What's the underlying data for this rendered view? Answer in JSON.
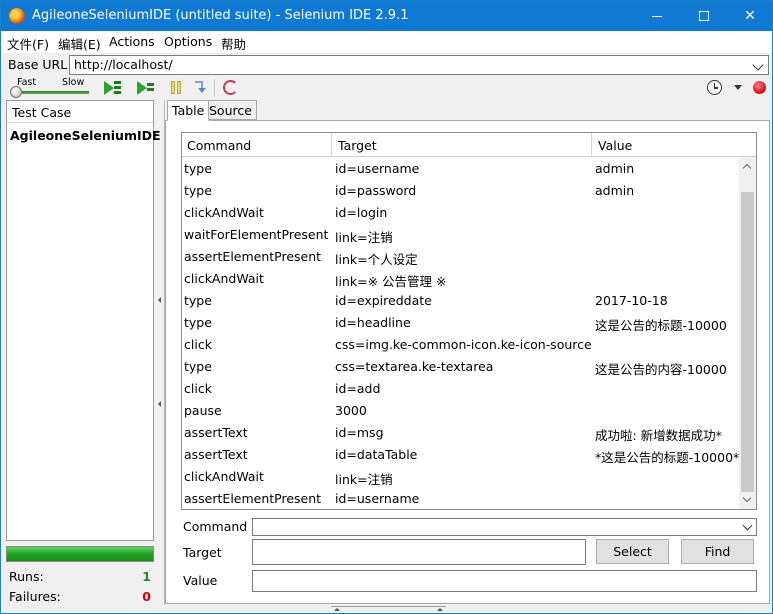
{
  "window": {
    "title": "AgileoneSeleniumIDE (untitled suite) - Selenium IDE 2.9.1"
  },
  "menu": [
    "文件(F)",
    "编辑(E)",
    "Actions",
    "Options",
    "帮助"
  ],
  "base_url": {
    "label": "Base URL",
    "value": "http://localhost/"
  },
  "speed": {
    "fast_label": "Fast",
    "slow_label": "Slow",
    "level": 0
  },
  "toolbar_icons": [
    "play-suite-icon",
    "play-test-icon",
    "pause-icon",
    "step-icon",
    "rollup-icon",
    "clock-icon",
    "record-icon"
  ],
  "test_case_panel": {
    "header": "Test Case",
    "items": [
      "AgileoneSeleniumIDE"
    ]
  },
  "stats": {
    "runs_label": "Runs:",
    "runs_value": "1",
    "failures_label": "Failures:",
    "failures_value": "0",
    "runs_color": "#1e8c1e",
    "failures_color": "#d00000",
    "progress_color": "#21a321"
  },
  "tabs": [
    "Table",
    "Source"
  ],
  "table": {
    "headers": [
      "Command",
      "Target",
      "Value"
    ],
    "rows": [
      {
        "command": "type",
        "target": "id=username",
        "value": "admin"
      },
      {
        "command": "type",
        "target": "id=password",
        "value": "admin"
      },
      {
        "command": "clickAndWait",
        "target": "id=login",
        "value": ""
      },
      {
        "command": "waitForElementPresent",
        "target": "link=注销",
        "value": ""
      },
      {
        "command": "assertElementPresent",
        "target": "link=个人设定",
        "value": ""
      },
      {
        "command": "clickAndWait",
        "target": "link=※ 公告管理 ※",
        "value": ""
      },
      {
        "command": "type",
        "target": "id=expireddate",
        "value": "2017-10-18"
      },
      {
        "command": "type",
        "target": "id=headline",
        "value": "这是公告的标题-10000"
      },
      {
        "command": "click",
        "target": "css=img.ke-common-icon.ke-icon-source",
        "value": ""
      },
      {
        "command": "type",
        "target": "css=textarea.ke-textarea",
        "value": "这是公告的内容-10000"
      },
      {
        "command": "click",
        "target": "id=add",
        "value": ""
      },
      {
        "command": "pause",
        "target": "3000",
        "value": ""
      },
      {
        "command": "assertText",
        "target": "id=msg",
        "value": "成功啦: 新增数据成功*"
      },
      {
        "command": "assertText",
        "target": "id=dataTable",
        "value": "*这是公告的标题-10000*"
      },
      {
        "command": "clickAndWait",
        "target": "link=注销",
        "value": ""
      },
      {
        "command": "assertElementPresent",
        "target": "id=username",
        "value": ""
      }
    ]
  },
  "form": {
    "command_label": "Command",
    "command_value": "",
    "target_label": "Target",
    "target_value": "",
    "value_label": "Value",
    "value_value": "",
    "select_button": "Select",
    "find_button": "Find"
  }
}
